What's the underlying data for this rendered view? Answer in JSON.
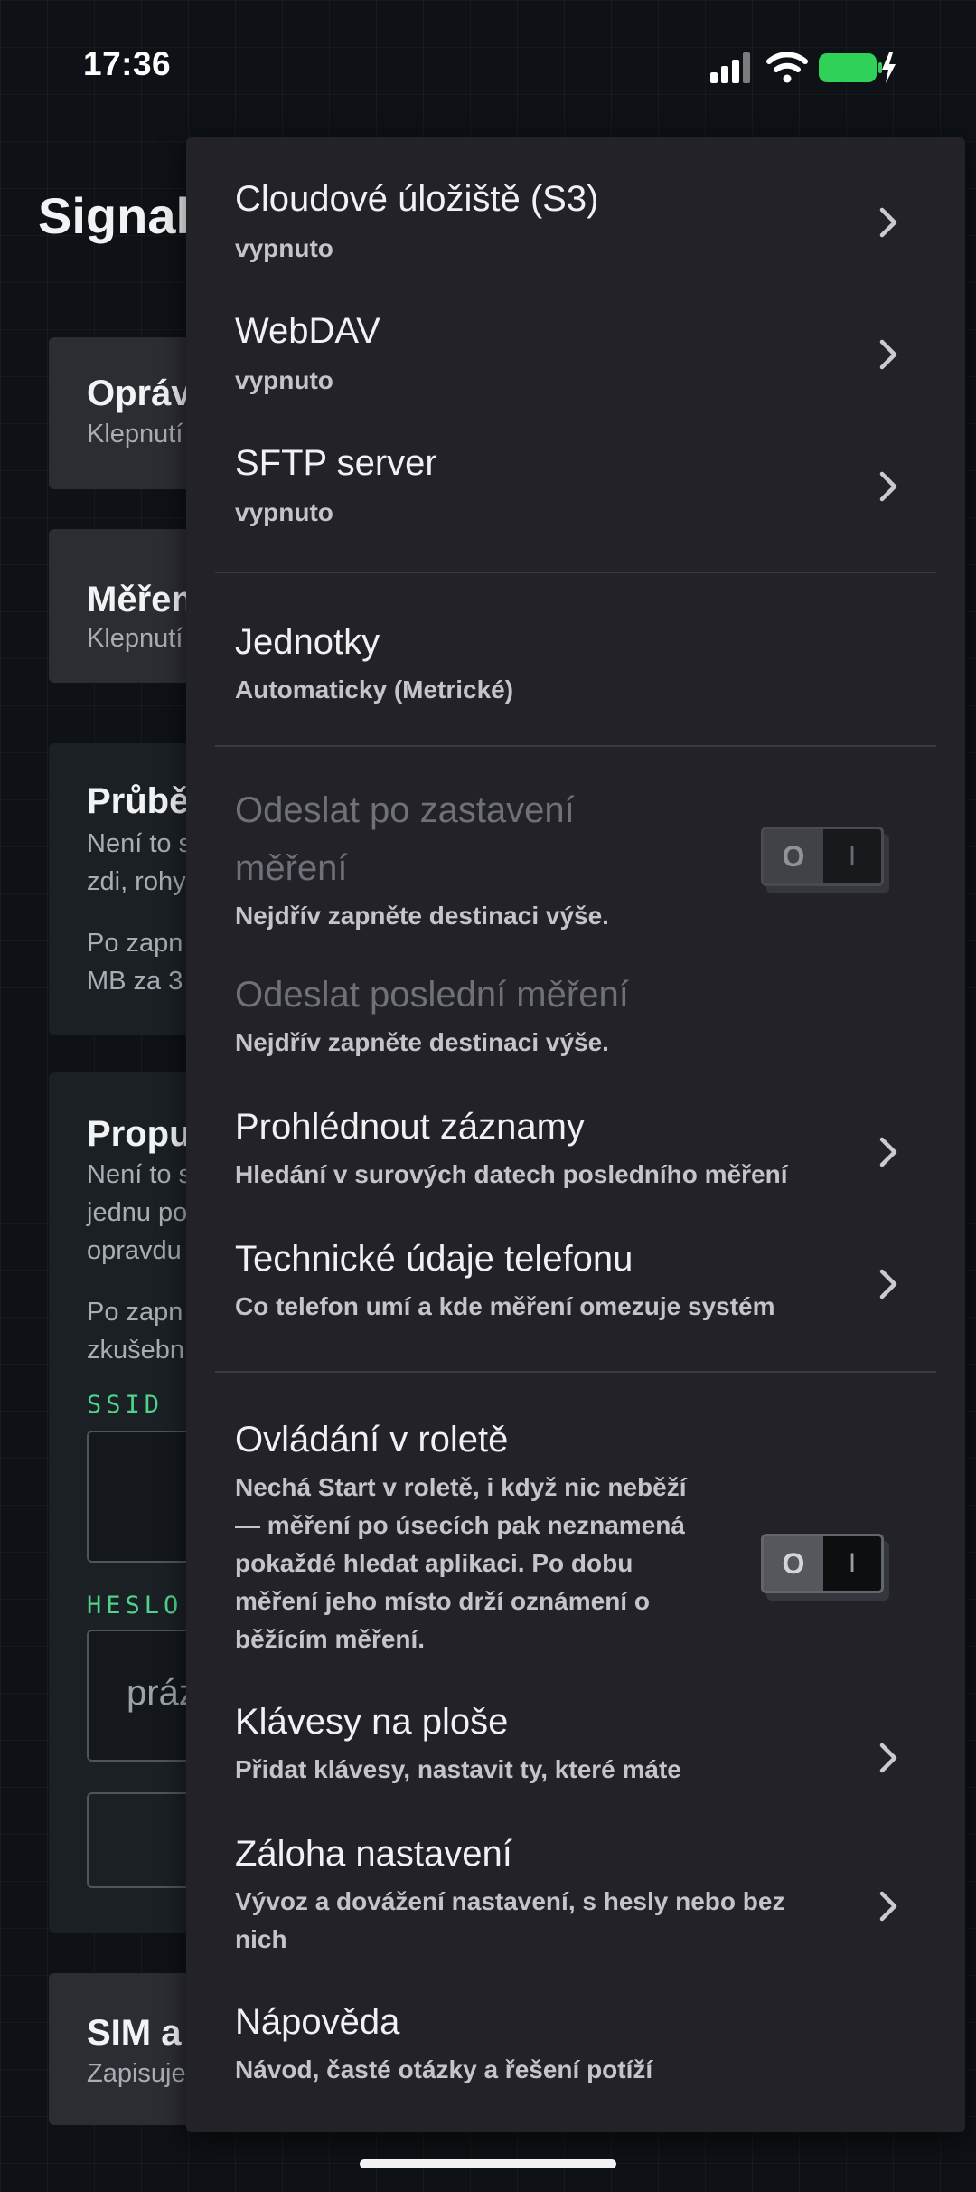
{
  "status_bar": {
    "time": "17:36",
    "icons": [
      "cellular-signal-icon",
      "wifi-icon",
      "battery-charging-icon"
    ],
    "battery_color": "#2fd158"
  },
  "background_app": {
    "title": "Signal",
    "cards": [
      {
        "title": "Opráv",
        "subtitle": "Klepnutí"
      },
      {
        "title": "Měřen",
        "subtitle": "Klepnutí"
      },
      {
        "title": "Průbě",
        "lines": [
          "Není to s",
          "zdi, rohy",
          "Po zapn",
          "MB za 3"
        ]
      },
      {
        "title": "Propu",
        "lines": [
          "Není to s",
          "jednu po",
          "opravdu",
          "Po zapn",
          "zkušebn"
        ],
        "ssid_label": "SSID",
        "password_label": "HESLO",
        "password_placeholder": "práz"
      },
      {
        "title": "SIM a",
        "subtitle": "Zapisuje"
      }
    ]
  },
  "menu": {
    "cloud": {
      "title": "Cloudové úložiště (S3)",
      "subtitle": "vypnuto"
    },
    "webdav": {
      "title": "WebDAV",
      "subtitle": "vypnuto"
    },
    "sftp": {
      "title": "SFTP server",
      "subtitle": "vypnuto"
    },
    "units": {
      "title": "Jednotky",
      "subtitle": "Automaticky (Metrické)"
    },
    "send_after_stop": {
      "title_line1": "Odeslat po zastavení",
      "title_line2": "měření",
      "subtitle": "Nejdřív zapněte destinaci výše.",
      "toggle_off": "O",
      "toggle_on": "I",
      "enabled": false,
      "checked": false
    },
    "send_last": {
      "title": "Odeslat poslední měření",
      "subtitle": "Nejdřív zapněte destinaci výše."
    },
    "browse_records": {
      "title": "Prohlédnout záznamy",
      "subtitle": "Hledání v surových datech posledního měření"
    },
    "phone_tech": {
      "title": "Technické údaje telefonu",
      "subtitle": "Co telefon umí a kde měření omezuje systém"
    },
    "shade_control": {
      "title": "Ovládání v roletě",
      "subtitle_lines": [
        "Nechá Start v roletě, i když nic neběží",
        "— měření po úsecích pak neznamená",
        "pokaždé hledat aplikaci. Po dobu",
        "měření jeho místo drží oznámení o",
        "běžícím měření."
      ],
      "toggle_off": "O",
      "toggle_on": "I",
      "enabled": true,
      "checked": false
    },
    "desktop_keys": {
      "title": "Klávesy na ploše",
      "subtitle": "Přidat klávesy, nastavit ty, které máte"
    },
    "backup": {
      "title": "Záloha nastavení",
      "subtitle_line1": "Vývoz a dovážení nastavení, s hesly nebo bez",
      "subtitle_line2": "nich"
    },
    "help": {
      "title": "Nápověda",
      "subtitle": "Návod, časté otázky a řešení potíží"
    }
  }
}
